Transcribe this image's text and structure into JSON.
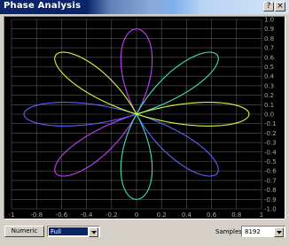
{
  "window": {
    "title": "Phase Analysis"
  },
  "titlebar_buttons": {
    "help": "?",
    "close": "×"
  },
  "chart_data": {
    "type": "line",
    "title": "",
    "xlabel": "",
    "ylabel": "",
    "xlim": [
      -1,
      1
    ],
    "ylim": [
      -1,
      1
    ],
    "grid": true,
    "x_ticks": [
      "-1",
      "-0.8",
      "-0.6",
      "-0.4",
      "-0.2",
      "0",
      "0.2",
      "0.4",
      "0.6",
      "0.8",
      "1"
    ],
    "y_ticks": [
      "1.0",
      "0.9",
      "0.8",
      "0.7",
      "0.6",
      "0.5",
      "0.4",
      "0.3",
      "0.2",
      "0.1",
      "0.0",
      "-0.1",
      "-0.2",
      "-0.3",
      "-0.4",
      "-0.5",
      "-0.6",
      "-0.7",
      "-0.8",
      "-0.9",
      "-1.0"
    ],
    "curve": {
      "kind": "rose",
      "petals": 8,
      "amplitude": 0.9
    },
    "colors": [
      "#c040ff",
      "#6060ff",
      "#40e0c0",
      "#d0ff40"
    ]
  },
  "controls": {
    "numeric_button": "Numeric",
    "range_value": "Full",
    "samples_label": "Samples",
    "samples_value": "8192"
  }
}
